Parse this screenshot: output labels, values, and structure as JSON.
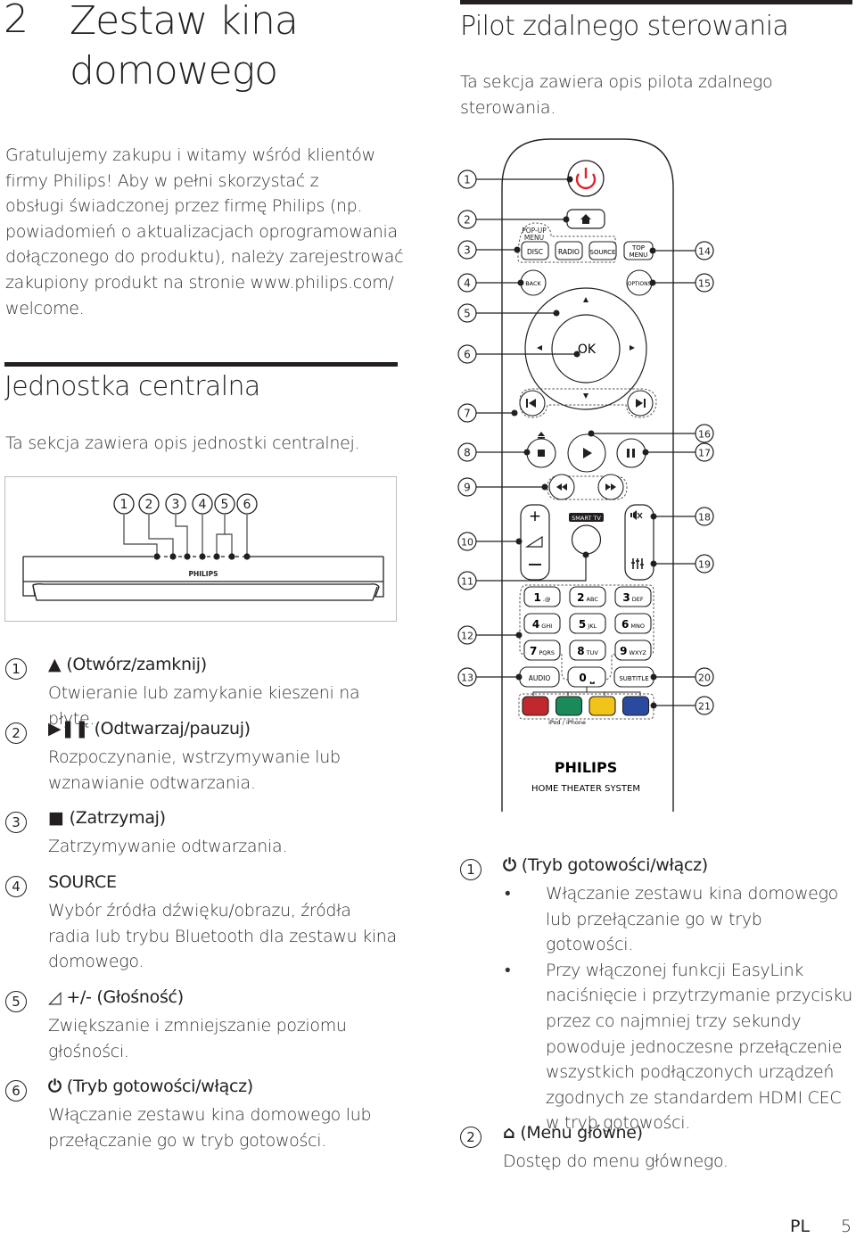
{
  "chapter": {
    "number": "2",
    "title": "Zestaw kina domowego"
  },
  "intro": {
    "lines": [
      "Gratulujemy zakupu i witamy wśród klientów",
      "firmy Philips! Aby w pełni skorzystać z",
      "obsługi świadczonej przez firmę Philips (np.",
      "powiadomień o aktualizacjach oprogramowania",
      "dołączonego do produktu), należy zarejestrować",
      "zakupiony produkt na stronie www.philips.com/",
      "welcome."
    ]
  },
  "main_unit": {
    "title": "Jednostka centralna",
    "subtitle": "Ta sekcja zawiera opis jednostki centralnej.",
    "diagram": {
      "brand": "PHILIPS",
      "callouts": [
        "1",
        "2",
        "3",
        "4",
        "5",
        "6"
      ]
    },
    "items": [
      {
        "num": "1",
        "icon": "eject-icon",
        "symbol": "▲",
        "head": "(Otwórz/zamknij)",
        "desc": [
          "Otwieranie lub zamykanie kieszeni na płytę."
        ]
      },
      {
        "num": "2",
        "icon": "play-pause-icon",
        "symbol": "▶❚❚",
        "head": "(Odtwarzaj/pauzuj)",
        "desc": [
          "Rozpoczynanie, wstrzymywanie lub",
          "wznawianie odtwarzania."
        ]
      },
      {
        "num": "3",
        "icon": "stop-icon",
        "symbol": "■",
        "head": "(Zatrzymaj)",
        "desc": [
          "Zatrzymywanie odtwarzania."
        ]
      },
      {
        "num": "4",
        "icon": "",
        "symbol": "",
        "head": "SOURCE",
        "desc": [
          "Wybór źródła dźwięku/obrazu, źródła",
          "radia lub trybu Bluetooth dla zestawu kina",
          "domowego."
        ]
      },
      {
        "num": "5",
        "icon": "volume-icon",
        "symbol": "◿",
        "head": "+/- (Głośność)",
        "desc": [
          "Zwiększanie i zmniejszanie poziomu",
          "głośności."
        ]
      },
      {
        "num": "6",
        "icon": "power-icon",
        "symbol": "⏻",
        "head": "(Tryb gotowości/włącz)",
        "desc": [
          "Włączanie zestawu kina domowego lub",
          "przełączanie go w tryb gotowości."
        ]
      }
    ]
  },
  "remote": {
    "title": "Pilot zdalnego sterowania",
    "subtitle_lines": [
      "Ta sekcja zawiera opis pilota zdalnego",
      "sterowania."
    ],
    "buttons": {
      "popup_menu": "POP-UP MENU",
      "disc": "DISC",
      "radio": "RADIO",
      "source": "SOURCE",
      "top_menu": "TOP MENU",
      "back": "BACK",
      "options": "OPTIONS",
      "ok": "OK",
      "smart_tv": "SMART TV",
      "audio": "AUDIO",
      "subtitle": "SUBTITLE",
      "ipod": "iPod / iPhone",
      "keypad": [
        {
          "digit": "1",
          "letters": ".@"
        },
        {
          "digit": "2",
          "letters": "ABC"
        },
        {
          "digit": "3",
          "letters": "DEF"
        },
        {
          "digit": "4",
          "letters": "GHI"
        },
        {
          "digit": "5",
          "letters": "JKL"
        },
        {
          "digit": "6",
          "letters": "MNO"
        },
        {
          "digit": "7",
          "letters": "PQRS"
        },
        {
          "digit": "8",
          "letters": "TUV"
        },
        {
          "digit": "9",
          "letters": "WXYZ"
        }
      ],
      "zero": "0 ⎵",
      "color_keys": [
        "#c0282d",
        "#1b8a5a",
        "#f2c318",
        "#2a4aa0"
      ]
    },
    "brand": "PHILIPS",
    "model_line": "HOME THEATER SYSTEM",
    "callouts_left": [
      "1",
      "2",
      "3",
      "4",
      "5",
      "6",
      "7",
      "8",
      "9",
      "10",
      "11",
      "12",
      "13"
    ],
    "callouts_right": [
      "14",
      "15",
      "16",
      "17",
      "18",
      "19",
      "20",
      "21"
    ],
    "power_color": "#e0202a",
    "items": [
      {
        "num": "1",
        "icon": "power-icon",
        "symbol": "⏻",
        "head": "(Tryb gotowości/włącz)",
        "bullets": [
          [
            "Włączanie zestawu kina domowego",
            "lub przełączanie go w tryb gotowości."
          ],
          [
            "Przy włączonej funkcji EasyLink",
            "naciśnięcie i przytrzymanie przycisku",
            "przez co najmniej trzy sekundy",
            "powoduje jednoczesne przełączenie",
            "wszystkich podłączonych urządzeń",
            "zgodnych ze standardem HDMI CEC",
            "w tryb gotowości."
          ]
        ]
      },
      {
        "num": "2",
        "icon": "home-icon",
        "symbol": "⌂",
        "head": "(Menu główne)",
        "desc": [
          "Dostęp do menu głównego."
        ]
      }
    ]
  },
  "footer": {
    "lang": "PL",
    "page": "5"
  }
}
